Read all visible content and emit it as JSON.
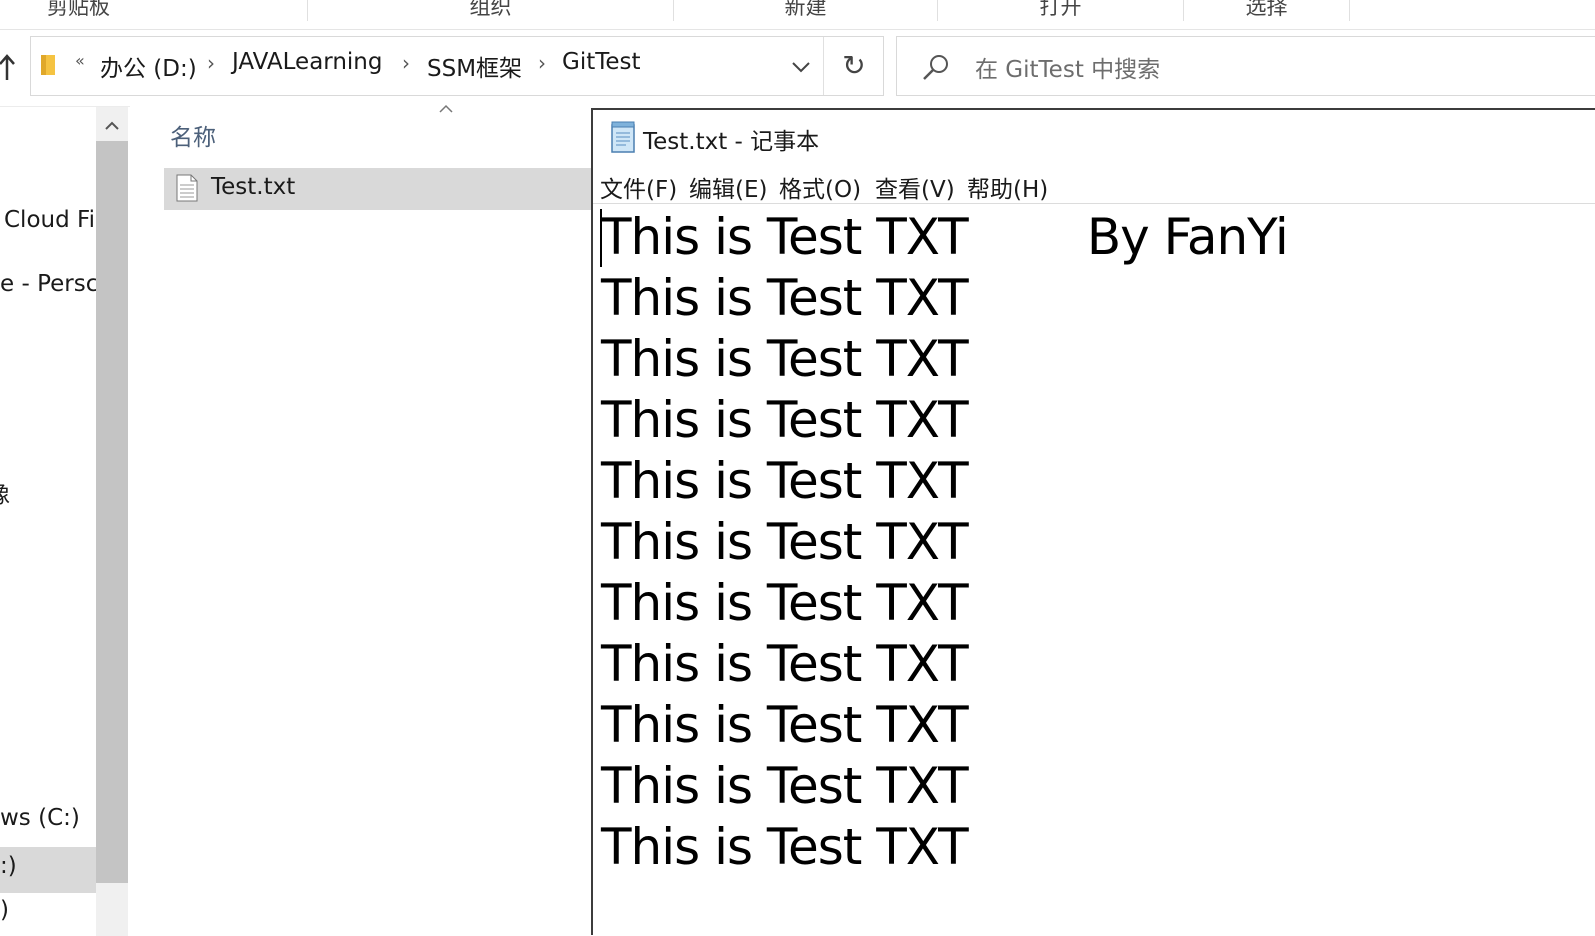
{
  "ribbon": {
    "groups": [
      "剪贴板",
      "组织",
      "新建",
      "打开",
      "选择"
    ]
  },
  "address_bar": {
    "overflow_chevron": "«",
    "crumbs": [
      "办公 (D:)",
      "JAVALearning",
      "SSM框架",
      "GitTest"
    ],
    "separator": "›"
  },
  "search": {
    "placeholder": "在 GitTest 中搜索"
  },
  "nav_pane": {
    "items": [
      "Cloud Fi",
      "e - Persc",
      "像",
      "ws (C:)",
      ":)",
      ")"
    ]
  },
  "file_list": {
    "column_header": "名称",
    "files": [
      {
        "name": "Test.txt"
      }
    ]
  },
  "notepad": {
    "title": "Test.txt - 记事本",
    "menus": [
      "文件(F)",
      "编辑(E)",
      "格式(O)",
      "查看(V)",
      "帮助(H)"
    ],
    "lines": [
      "This is Test TXT        By FanYi",
      "This is Test TXT",
      "This is Test TXT",
      "This is Test TXT",
      "This is Test TXT",
      "This is Test TXT",
      "This is Test TXT",
      "This is Test TXT",
      "This is Test TXT",
      "This is Test TXT",
      "This is Test TXT"
    ]
  },
  "colors": {
    "selection": "#d9d9d9",
    "header_text": "#4c607a",
    "folder": "#f5c342"
  },
  "icons": [
    "up-arrow-icon",
    "folder-icon",
    "chevron-down-icon",
    "refresh-icon",
    "search-icon",
    "text-file-icon",
    "notepad-icon",
    "scroll-up-icon"
  ]
}
